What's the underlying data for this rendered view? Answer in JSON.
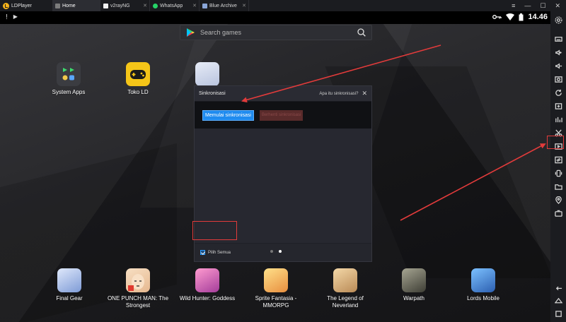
{
  "window": {
    "app_name": "LDPlayer",
    "tabs": [
      {
        "label": "Home",
        "color": "#7c7c7c"
      },
      {
        "label": "v2rayNG",
        "color": "#f0f0f0"
      },
      {
        "label": "WhatsApp",
        "color": "#25d366"
      },
      {
        "label": "Blue Archive",
        "color": "#8aa6d8"
      }
    ],
    "controls": [
      "≡",
      "—",
      "☐",
      "✕"
    ]
  },
  "status": {
    "time": "14.46"
  },
  "search": {
    "placeholder": "Search games"
  },
  "desktop_apps": [
    {
      "label": "System Apps"
    },
    {
      "label": "Toko LD"
    }
  ],
  "dialog": {
    "title": "Sinkronisasi",
    "help": "Apa itu sinkronisasi?",
    "start_button": "Memulai sinkronisasi",
    "stop_button": "Berhenti sinkronisasi",
    "select_all": "Pilih Semua"
  },
  "dock_apps": [
    {
      "label": "Final Gear",
      "color": "#9fb8e8"
    },
    {
      "label": "ONE PUNCH MAN: The Strongest",
      "color": "#f2c9a3"
    },
    {
      "label": "Wild Hunter: Goddess",
      "color": "#e86aa8"
    },
    {
      "label": "Sprite Fantasia - MMORPG",
      "color": "#f3b85a"
    },
    {
      "label": "The Legend of Neverland",
      "color": "#d9b178"
    },
    {
      "label": "Warpath",
      "color": "#7a7a6a"
    },
    {
      "label": "Lords Mobile",
      "color": "#4a8fd8"
    }
  ],
  "colors": {
    "accent": "#1f8bef",
    "annotation": "#e23b3b",
    "toko_ld": "#f5c518"
  }
}
